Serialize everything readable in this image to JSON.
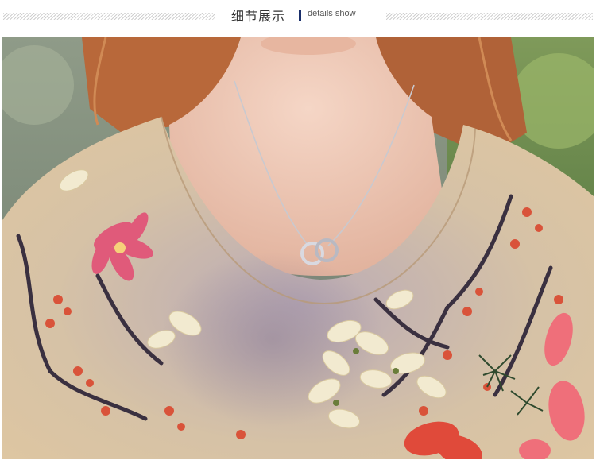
{
  "header": {
    "title_cn": "细节展示",
    "title_en": "details show"
  },
  "colors": {
    "accent_bar": "#1a2f6b",
    "hatch": "#cfcfcf",
    "blouse_base": "#d8c0a0",
    "blossom_pink": "#e05a7a",
    "blossom_cream": "#f2ead0",
    "branch": "#3a3040",
    "hair": "#b8683a",
    "skin": "#eec8b6"
  },
  "photo": {
    "icon": "product-detail-photo"
  }
}
